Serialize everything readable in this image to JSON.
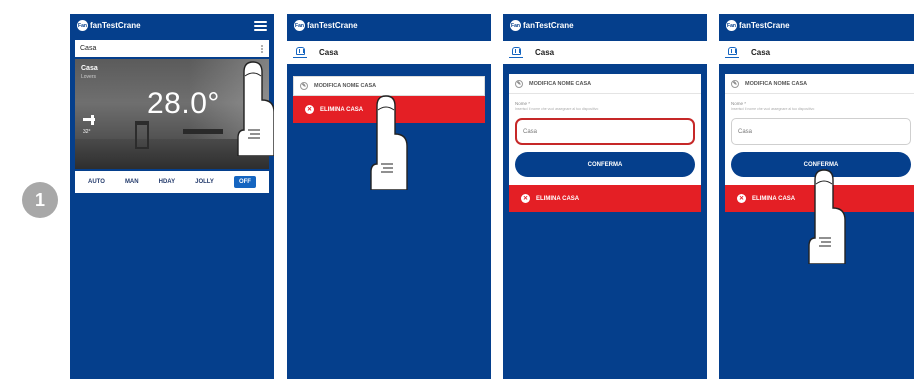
{
  "step_number": "1",
  "app": {
    "logo_text": "fanTestCrane",
    "logo_badge": "Fan"
  },
  "phone1": {
    "home_name": "Casa",
    "room_name": "Casa",
    "room_sub": "Lovers",
    "temperature": "28.0°",
    "small_value": "32°",
    "modes": [
      "AUTO",
      "MAN",
      "HDAY",
      "JOLLY",
      "OFF"
    ],
    "active_mode": "OFF"
  },
  "phone2": {
    "title": "Casa",
    "edit_option": "MODIFICA NOME CASA",
    "delete_option": "ELIMINA CASA"
  },
  "phone3": {
    "title": "Casa",
    "edit_option": "MODIFICA NOME CASA",
    "field_label": "Nome *",
    "field_hint": "Inserisci il nome che vuoi assegnare al tuo dispositivo",
    "input_value": "Casa",
    "confirm_label": "CONFERMA",
    "delete_option": "ELIMINA CASA"
  },
  "phone4": {
    "title": "Casa",
    "edit_option": "MODIFICA NOME CASA",
    "field_label": "Nome *",
    "field_hint": "Inserisci il nome che vuoi assegnare al tuo dispositivo",
    "input_value": "Casa",
    "confirm_label": "CONFERMA",
    "delete_option": "ELIMINA CASA"
  },
  "colors": {
    "app_blue": "#053f8c",
    "delete_red": "#e41f25",
    "focus_red": "#c62828",
    "accent_blue": "#1565c0"
  }
}
